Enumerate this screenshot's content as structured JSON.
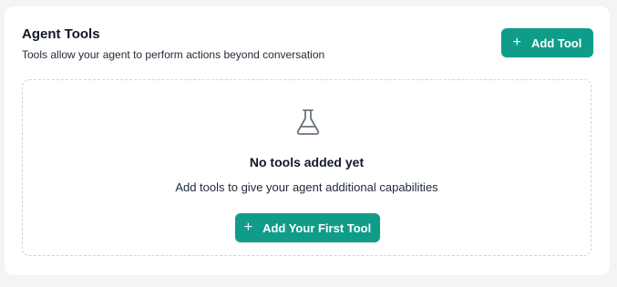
{
  "header": {
    "title": "Agent Tools",
    "subtitle": "Tools allow your agent to perform actions beyond conversation",
    "add_button_label": "Add Tool",
    "add_button_icon": "plus-icon"
  },
  "empty_state": {
    "icon": "flask-icon",
    "title": "No tools added yet",
    "description": "Add tools to give your agent additional capabilities",
    "button_label": "Add Your First Tool",
    "button_icon": "plus-icon"
  },
  "colors": {
    "accent": "#0f9d8a",
    "card_background": "#ffffff",
    "page_background": "#f3f4f6",
    "dashed_border": "#d1d5db"
  }
}
